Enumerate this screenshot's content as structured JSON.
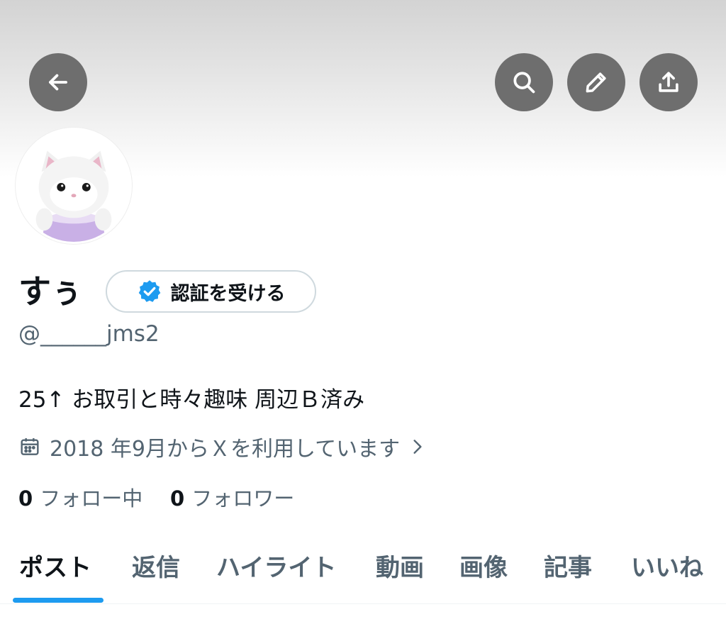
{
  "header": {
    "back_icon": "arrow-left-icon",
    "search_icon": "search-icon",
    "edit_icon": "pencil-icon",
    "share_icon": "share-upload-icon",
    "button_color": "#6e6e6e"
  },
  "profile": {
    "name": "すぅ",
    "verify_button_label": "認証を受ける",
    "verify_icon": "verified-badge-icon",
    "handle": "@______jms2",
    "bio": "25↑ お取引と時々趣味 周辺Ｂ済み",
    "joined_text": "2018 年9月からＸを利用しています",
    "joined_icon": "calendar-icon"
  },
  "stats": {
    "following_count": "0",
    "following_label": "フォロー中",
    "followers_count": "0",
    "followers_label": "フォロワー"
  },
  "tabs": [
    {
      "label": "ポスト",
      "active": true
    },
    {
      "label": "返信",
      "active": false
    },
    {
      "label": "ハイライト",
      "active": false
    },
    {
      "label": "動画",
      "active": false
    },
    {
      "label": "画像",
      "active": false
    },
    {
      "label": "記事",
      "active": false
    },
    {
      "label": "いいね",
      "active": false
    }
  ],
  "colors": {
    "accent": "#1d9bf0",
    "text_primary": "#0f1419",
    "text_secondary": "#536471"
  }
}
